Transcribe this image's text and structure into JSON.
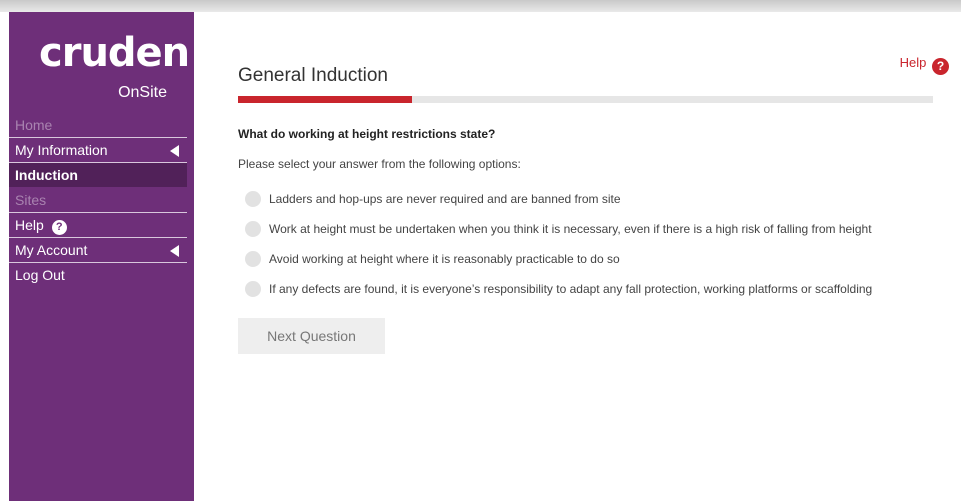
{
  "brand": {
    "logo_word": "cruden",
    "logo_sub": "OnSite"
  },
  "sidebar": {
    "items": [
      {
        "label": "Home"
      },
      {
        "label": "My Information"
      },
      {
        "label": "Induction"
      },
      {
        "label": "Sites"
      },
      {
        "label": "Help"
      },
      {
        "label": "My Account"
      },
      {
        "label": "Log Out"
      }
    ],
    "help_badge": "?"
  },
  "header": {
    "help_label": "Help",
    "help_badge": "?"
  },
  "main": {
    "title": "General Induction",
    "progress_fraction": 0.25,
    "question": "What do working at height restrictions state?",
    "instructions": "Please select your answer from the following options:",
    "options": [
      {
        "label": "Ladders and hop-ups are never required and are banned from site"
      },
      {
        "label": "Work at height must be undertaken when you think it is necessary, even if there is a high risk of falling from height"
      },
      {
        "label": "Avoid working at height where it is reasonably practicable to do so"
      },
      {
        "label": "If any defects are found, it is everyone’s responsibility to adapt any fall protection, working platforms or scaffolding"
      }
    ],
    "next_button_label": "Next Question"
  },
  "colors": {
    "sidebar": "#6e2f79",
    "sidebar_active": "#512159",
    "accent": "#c9252d",
    "progress_track": "#e6e6e6"
  }
}
